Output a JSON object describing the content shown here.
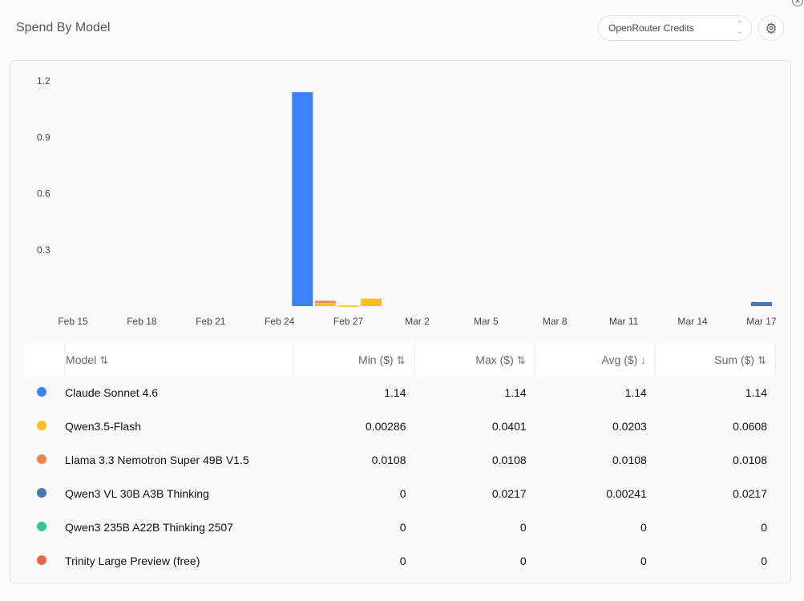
{
  "header": {
    "title": "Spend By Model",
    "select_value": "OpenRouter Credits",
    "settings_icon": "gear-icon",
    "close_icon": "close-icon"
  },
  "chart_data": {
    "type": "bar",
    "stacked": true,
    "x_tick_labels": [
      "Feb 15",
      "Feb 18",
      "Feb 21",
      "Feb 24",
      "Feb 27",
      "Mar 2",
      "Mar 5",
      "Mar 8",
      "Mar 11",
      "Mar 14",
      "Mar 17"
    ],
    "y_tick_labels": [
      "0.3",
      "0.6",
      "0.9",
      "1.2"
    ],
    "ylim": [
      0,
      1.2
    ],
    "grid": false,
    "series": [
      {
        "name": "Claude Sonnet 4.6",
        "color": "#3b82f6",
        "points": [
          {
            "x": "Feb 25",
            "y": 1.14
          }
        ]
      },
      {
        "name": "Qwen3.5-Flash",
        "color": "#fbbf24",
        "points": [
          {
            "x": "Feb 26",
            "y": 0.0178
          },
          {
            "x": "Feb 27",
            "y": 0.00286
          },
          {
            "x": "Feb 28",
            "y": 0.0401
          }
        ]
      },
      {
        "name": "Llama 3.3 Nemotron Super 49B V1.5",
        "color": "#f0844a",
        "points": [
          {
            "x": "Feb 26",
            "y": 0.0108
          }
        ]
      },
      {
        "name": "Qwen3 VL 30B A3B Thinking",
        "color": "#4a77b0",
        "points": [
          {
            "x": "Mar 17",
            "y": 0.0217
          }
        ]
      }
    ]
  },
  "table": {
    "columns": [
      {
        "label": "Model",
        "sort": "⇅"
      },
      {
        "label": "Min ($)",
        "sort": "⇅"
      },
      {
        "label": "Max ($)",
        "sort": "⇅"
      },
      {
        "label": "Avg ($)",
        "sort": "↓"
      },
      {
        "label": "Sum ($)",
        "sort": "⇅"
      }
    ],
    "rows": [
      {
        "model": "Claude Sonnet 4.6",
        "color": "#3b82f6",
        "min": "1.14",
        "max": "1.14",
        "avg": "1.14",
        "sum": "1.14"
      },
      {
        "model": "Qwen3.5-Flash",
        "color": "#fbbf24",
        "min": "0.00286",
        "max": "0.0401",
        "avg": "0.0203",
        "sum": "0.0608"
      },
      {
        "model": "Llama 3.3 Nemotron Super 49B V1.5",
        "color": "#f0844a",
        "min": "0.0108",
        "max": "0.0108",
        "avg": "0.0108",
        "sum": "0.0108"
      },
      {
        "model": "Qwen3 VL 30B A3B Thinking",
        "color": "#4a77b0",
        "min": "0",
        "max": "0.0217",
        "avg": "0.00241",
        "sum": "0.0217"
      },
      {
        "model": "Qwen3 235B A22B Thinking 2507",
        "color": "#34c49a",
        "min": "0",
        "max": "0",
        "avg": "0",
        "sum": "0"
      },
      {
        "model": "Trinity Large Preview (free)",
        "color": "#f0654a",
        "min": "0",
        "max": "0",
        "avg": "0",
        "sum": "0"
      }
    ]
  }
}
